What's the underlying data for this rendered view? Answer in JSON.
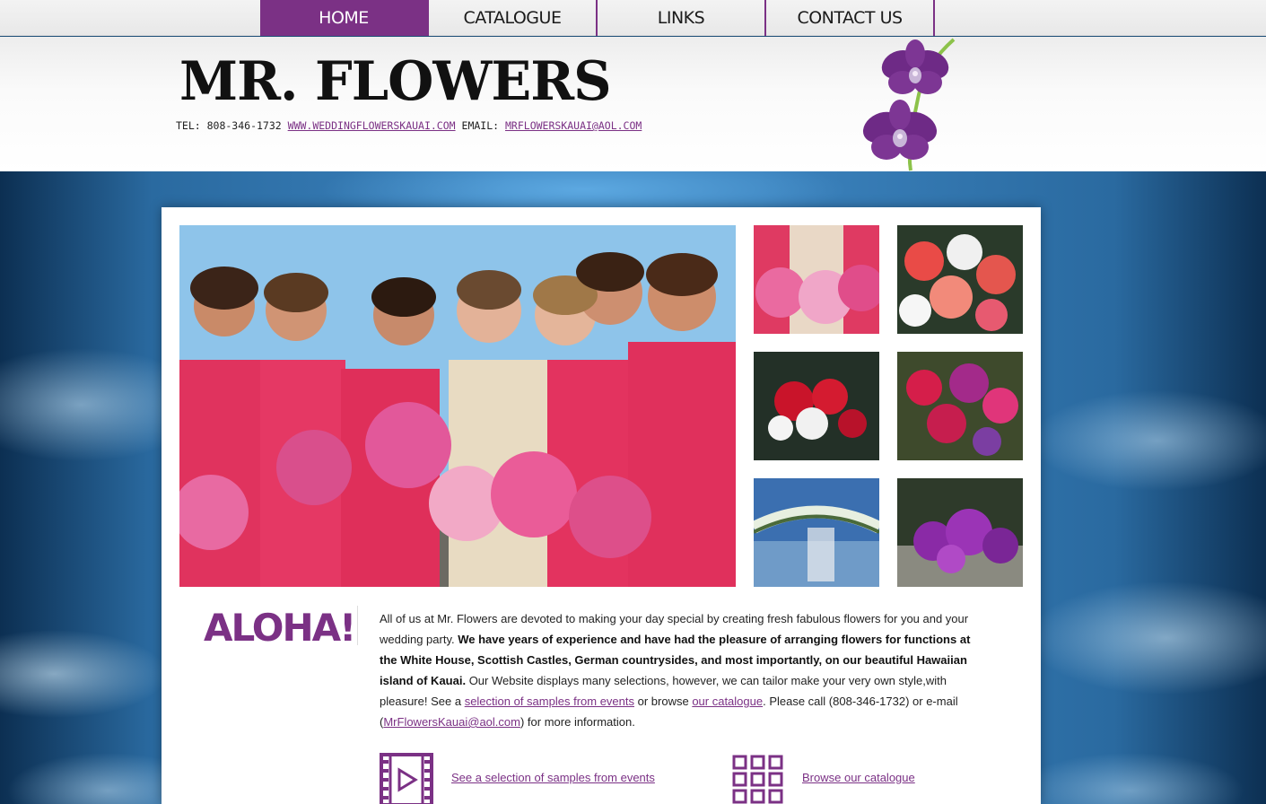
{
  "nav": {
    "items": [
      {
        "label": "HOME",
        "active": true
      },
      {
        "label": "CATALOGUE",
        "active": false
      },
      {
        "label": "LINKS",
        "active": false
      },
      {
        "label": "CONTACT US",
        "active": false
      }
    ]
  },
  "header": {
    "logo": "MR. FLOWERS",
    "tel_label": "TEL: 808-346-1732",
    "website": "WWW.WEDDINGFLOWERSKAUAI.COM",
    "email_label": "EMAIL:",
    "email": "MRFLOWERSKAUAI@AOL.COM"
  },
  "main": {
    "heading": "ALOHA!",
    "intro": {
      "p1": "All of us at Mr. Flowers are devoted to making your day special by creating fresh fabulous flowers for you and your wedding party. ",
      "bold": "We have years of experience and have had the pleasure of arranging flowers for functions at the White House, Scottish Castles, German countrysides, and most importantly, on our beautiful Hawaiian island of Kauai.",
      "p2": " Our Website displays many selections, however, we can tailor make your very own style,with pleasure! See a ",
      "link_samples": "selection of samples from events",
      "p3": " or browse ",
      "link_catalogue": "our catalogue",
      "p4": ". Please call (808-346-1732) or e-mail (",
      "link_email": "MrFlowersKauai@aol.com",
      "p5": ") for more information."
    },
    "cta_samples": "See a selection of samples from events ",
    "cta_catalogue": "Browse our catalogue"
  },
  "colors": {
    "accent": "#7b3185",
    "ocean": "#3b82bd",
    "dress": "#e5345f"
  },
  "icons": {
    "samples": "film-play-icon",
    "catalogue": "grid-icon"
  }
}
